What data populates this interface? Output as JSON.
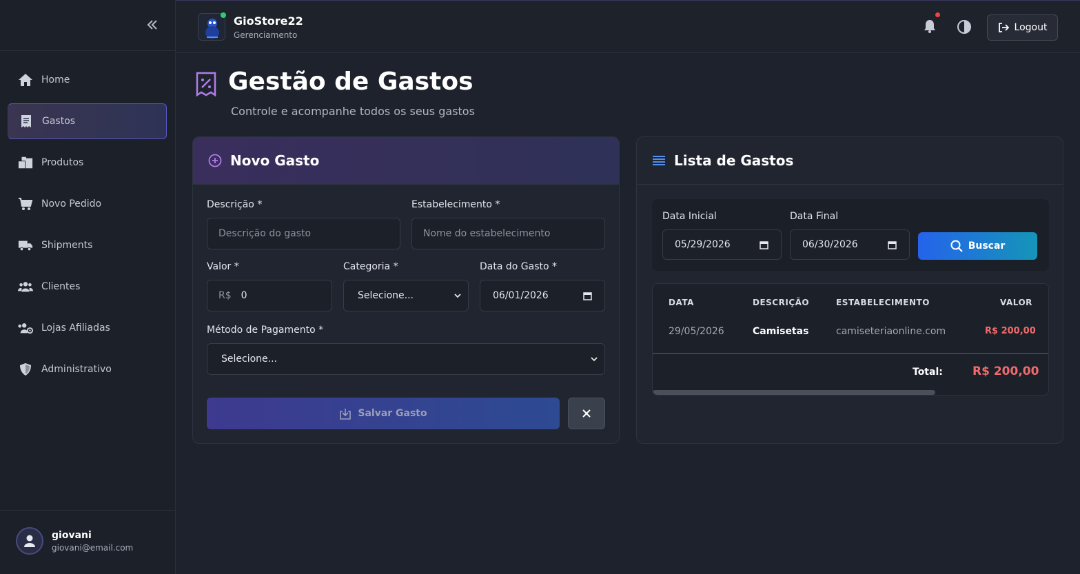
{
  "sidebar": {
    "collapse_icon": "double-chevron-left-icon",
    "items": [
      {
        "label": "Home",
        "icon": "home-icon",
        "active": false
      },
      {
        "label": "Gastos",
        "icon": "receipt-icon",
        "active": true
      },
      {
        "label": "Produtos",
        "icon": "boxes-icon",
        "active": false
      },
      {
        "label": "Novo Pedido",
        "icon": "cart-icon",
        "active": false
      },
      {
        "label": "Shipments",
        "icon": "truck-icon",
        "active": false
      },
      {
        "label": "Clientes",
        "icon": "users-icon",
        "active": false
      },
      {
        "label": "Lojas Afiliadas",
        "icon": "users-gear-icon",
        "active": false
      },
      {
        "label": "Administrativo",
        "icon": "shield-icon",
        "active": false
      }
    ],
    "user": {
      "name": "giovani",
      "email": "giovani@email.com"
    }
  },
  "topbar": {
    "brand": "GioStore22",
    "subtitle": "Gerenciamento",
    "logout_label": "Logout"
  },
  "page": {
    "title": "Gestão de Gastos",
    "subtitle": "Controle e acompanhe todos os seus gastos"
  },
  "form": {
    "title": "Novo Gasto",
    "descricao_label": "Descrição *",
    "descricao_placeholder": "Descrição do gasto",
    "estabelecimento_label": "Estabelecimento *",
    "estabelecimento_placeholder": "Nome do estabelecimento",
    "valor_label": "Valor *",
    "valor_prefix": "R$",
    "valor_value": "0",
    "categoria_label": "Categoria *",
    "categoria_value": "Selecione...",
    "data_label": "Data do Gasto *",
    "data_value": "06/01/2026",
    "metodo_label": "Método de Pagamento *",
    "metodo_value": "Selecione...",
    "save_label": "Salvar Gasto"
  },
  "list": {
    "title": "Lista de Gastos",
    "data_inicial_label": "Data Inicial",
    "data_inicial_value": "05/29/2026",
    "data_final_label": "Data Final",
    "data_final_value": "06/30/2026",
    "buscar_label": "Buscar",
    "columns": [
      "DATA",
      "DESCRIÇÃO",
      "ESTABELECIMENTO",
      "VALOR"
    ],
    "rows": [
      {
        "data": "29/05/2026",
        "descricao": "Camisetas",
        "estabelecimento": "camiseteriaonline.com",
        "valor": "R$ 200,00"
      }
    ],
    "total_label": "Total:",
    "total_value": "R$ 200,00"
  },
  "colors": {
    "accent": "#6c63ff",
    "primary_blue": "#2563eb",
    "danger": "#f06b6b"
  }
}
